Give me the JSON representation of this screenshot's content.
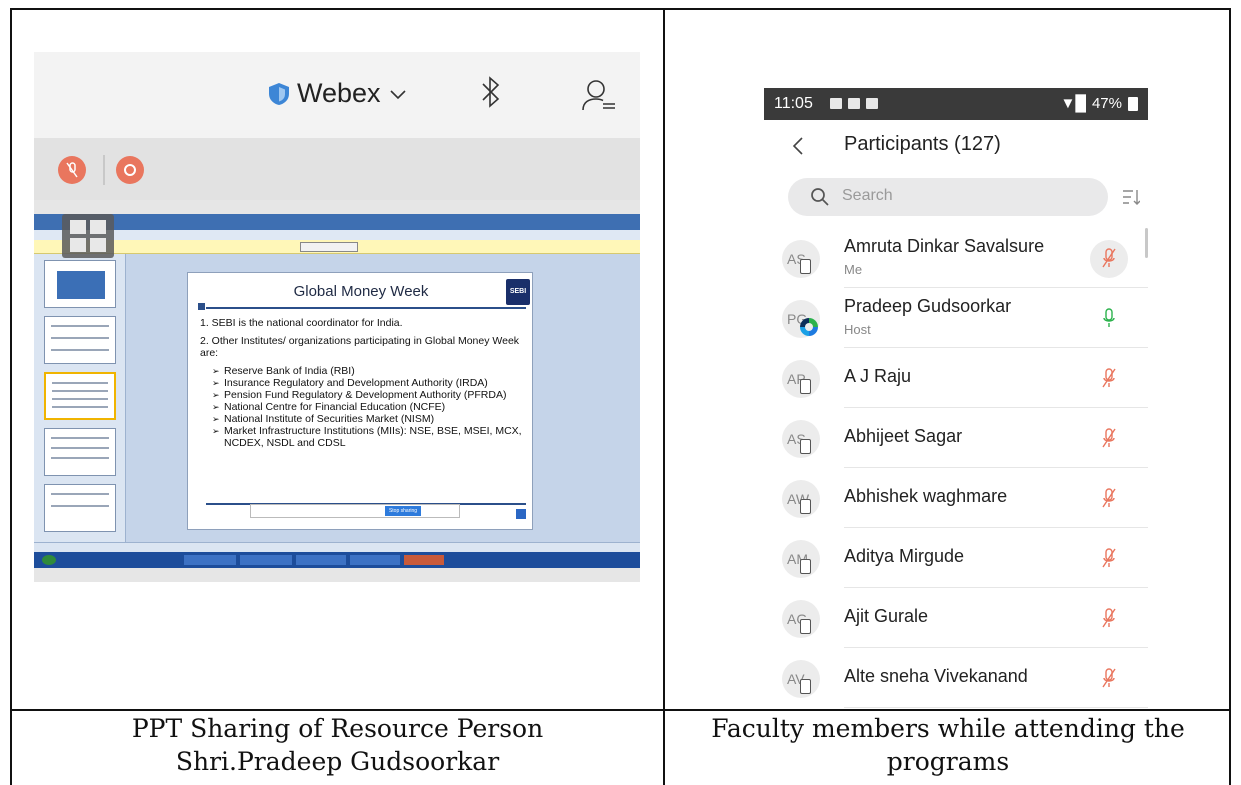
{
  "captions": {
    "left_line1": "PPT Sharing of Resource Person",
    "left_line2": "Shri.Pradeep Gudsoorkar",
    "right_line1": "Faculty members while attending the",
    "right_line2": "programs"
  },
  "webex": {
    "app_name": "Webex",
    "icons": [
      "shield-icon",
      "chevron-down-icon",
      "bluetooth-icon",
      "user-list-icon",
      "mic-muted-icon",
      "record-icon",
      "layout-grid-icon"
    ],
    "accent_color": "#e9765e",
    "shared_slide": {
      "title": "Global Money Week",
      "logo_text": "SEBI",
      "point1": "1. SEBI is the national coordinator for India.",
      "point2": "2. Other Institutes/ organizations participating in Global Money Week are:",
      "bullets": [
        "Reserve Bank of India (RBI)",
        "Insurance Regulatory and Development Authority (IRDA)",
        "Pension Fund Regulatory & Development Authority (PFRDA)",
        "National Centre for Financial Education (NCFE)",
        "National Institute of Securities Market (NISM)",
        "Market Infrastructure Institutions (MIIs): NSE, BSE, MSEI, MCX, NCDEX, NSDL and CDSL"
      ],
      "stop_sharing_label": "Stop sharing"
    }
  },
  "phone": {
    "status_time": "11:05",
    "battery": "47%",
    "title": "Participants (127)",
    "search_placeholder": "Search",
    "participants": [
      {
        "initials": "AS",
        "name": "Amruta Dinkar Savalsure",
        "role": "Me",
        "mic": "muted",
        "badge": "device"
      },
      {
        "initials": "PG",
        "name": "Pradeep Gudsoorkar",
        "role": "Host",
        "mic": "active",
        "badge": "host"
      },
      {
        "initials": "AP",
        "name": "A J Raju",
        "role": "",
        "mic": "muted",
        "badge": "device"
      },
      {
        "initials": "AS",
        "name": "Abhijeet Sagar",
        "role": "",
        "mic": "muted",
        "badge": "device"
      },
      {
        "initials": "AW",
        "name": "Abhishek waghmare",
        "role": "",
        "mic": "muted",
        "badge": "device"
      },
      {
        "initials": "AM",
        "name": "Aditya Mirgude",
        "role": "",
        "mic": "muted",
        "badge": "device"
      },
      {
        "initials": "AG",
        "name": "Ajit Gurale",
        "role": "",
        "mic": "muted",
        "badge": "device"
      },
      {
        "initials": "AV",
        "name": "Alte sneha Vivekanand",
        "role": "",
        "mic": "muted",
        "badge": "device"
      }
    ],
    "colors": {
      "mic_muted": "#e9765e",
      "mic_active": "#2bb24c"
    }
  }
}
